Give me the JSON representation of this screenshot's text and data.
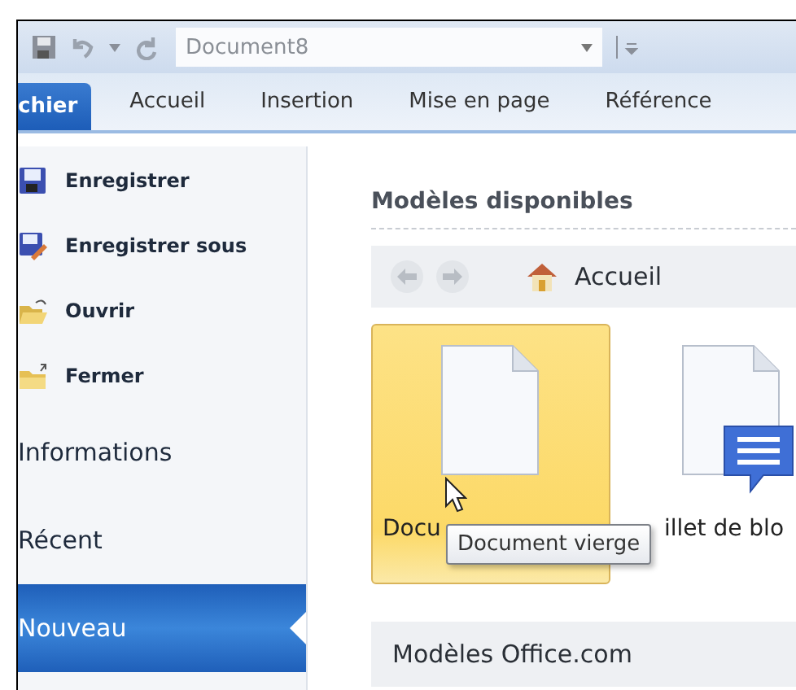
{
  "quick_access": {
    "document_title": "Document8"
  },
  "ribbon_tabs": [
    {
      "label": "chier",
      "selected": true
    },
    {
      "label": "Accueil",
      "selected": false
    },
    {
      "label": "Insertion",
      "selected": false
    },
    {
      "label": "Mise en page",
      "selected": false
    },
    {
      "label": "Référence",
      "selected": false
    }
  ],
  "backstage_menu": [
    {
      "label": "Enregistrer",
      "kind": "command",
      "selected": false
    },
    {
      "label": "Enregistrer sous",
      "kind": "command",
      "selected": false
    },
    {
      "label": "Ouvrir",
      "kind": "command",
      "selected": false
    },
    {
      "label": "Fermer",
      "kind": "command",
      "selected": false
    },
    {
      "label": "Informations",
      "kind": "page",
      "selected": false
    },
    {
      "label": "Récent",
      "kind": "page",
      "selected": false
    },
    {
      "label": "Nouveau",
      "kind": "page",
      "selected": true
    }
  ],
  "available_templates": {
    "title": "Modèles disponibles",
    "breadcrumb": "Accueil",
    "templates": [
      {
        "label": "Docu",
        "selected": true
      },
      {
        "label": "illet de blo",
        "selected": false
      }
    ],
    "tooltip": "Document vierge"
  },
  "office_templates": {
    "title": "Modèles Office.com"
  }
}
